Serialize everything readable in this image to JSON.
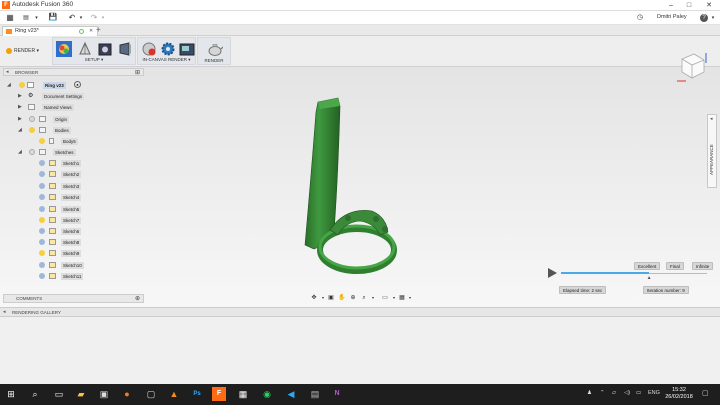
{
  "window": {
    "title": "Autodesk Fusion 360",
    "controls": {
      "minimize": "–",
      "maximize": "□",
      "close": "✕"
    }
  },
  "quick_access": {
    "user_name": "Dmitri Paley",
    "help_label": "?"
  },
  "document_tab": {
    "label": "Ring v23*",
    "close_label": "✕",
    "add_label": "+"
  },
  "ribbon": {
    "workspace_label": "RENDER ▾",
    "groups": [
      {
        "label": "SETUP ▾"
      },
      {
        "label": "IN-CANVAS RENDER ▾"
      },
      {
        "label": "RENDER"
      }
    ]
  },
  "browser": {
    "header": "BROWSER",
    "root": "Ring v23",
    "items": [
      {
        "label": "Document Settings"
      },
      {
        "label": "Named Views"
      },
      {
        "label": "Origin"
      },
      {
        "label": "Bodies"
      },
      {
        "label": "Body5"
      },
      {
        "label": "Sketches"
      },
      {
        "label": "Sketch1"
      },
      {
        "label": "Sketch2"
      },
      {
        "label": "Sketch3"
      },
      {
        "label": "Sketch4"
      },
      {
        "label": "Sketch5"
      },
      {
        "label": "Sketch7"
      },
      {
        "label": "Sketch6"
      },
      {
        "label": "Sketch8"
      },
      {
        "label": "Sketch9"
      },
      {
        "label": "Sketch10"
      },
      {
        "label": "Sketch11"
      }
    ]
  },
  "comments": {
    "header": "COMMENTS"
  },
  "gallery": {
    "header": "RENDERING GALLERY"
  },
  "appearance": {
    "label": "APPEARANCE"
  },
  "render_progress": {
    "elapsed": "Elapsed time: 2 sec",
    "iteration": "Iteration number: 9",
    "level_excellent": "Excellent",
    "level_final": "Final",
    "level_infinite": "Infinite",
    "progress_fraction": 0.6
  },
  "colors": {
    "model_green": "#3a8a3a",
    "accent_blue": "#4aa8e6",
    "taskbar": "#1e1e1e"
  },
  "taskbar": {
    "language": "ENG",
    "time": "15:32",
    "date": "26/02/2018"
  }
}
